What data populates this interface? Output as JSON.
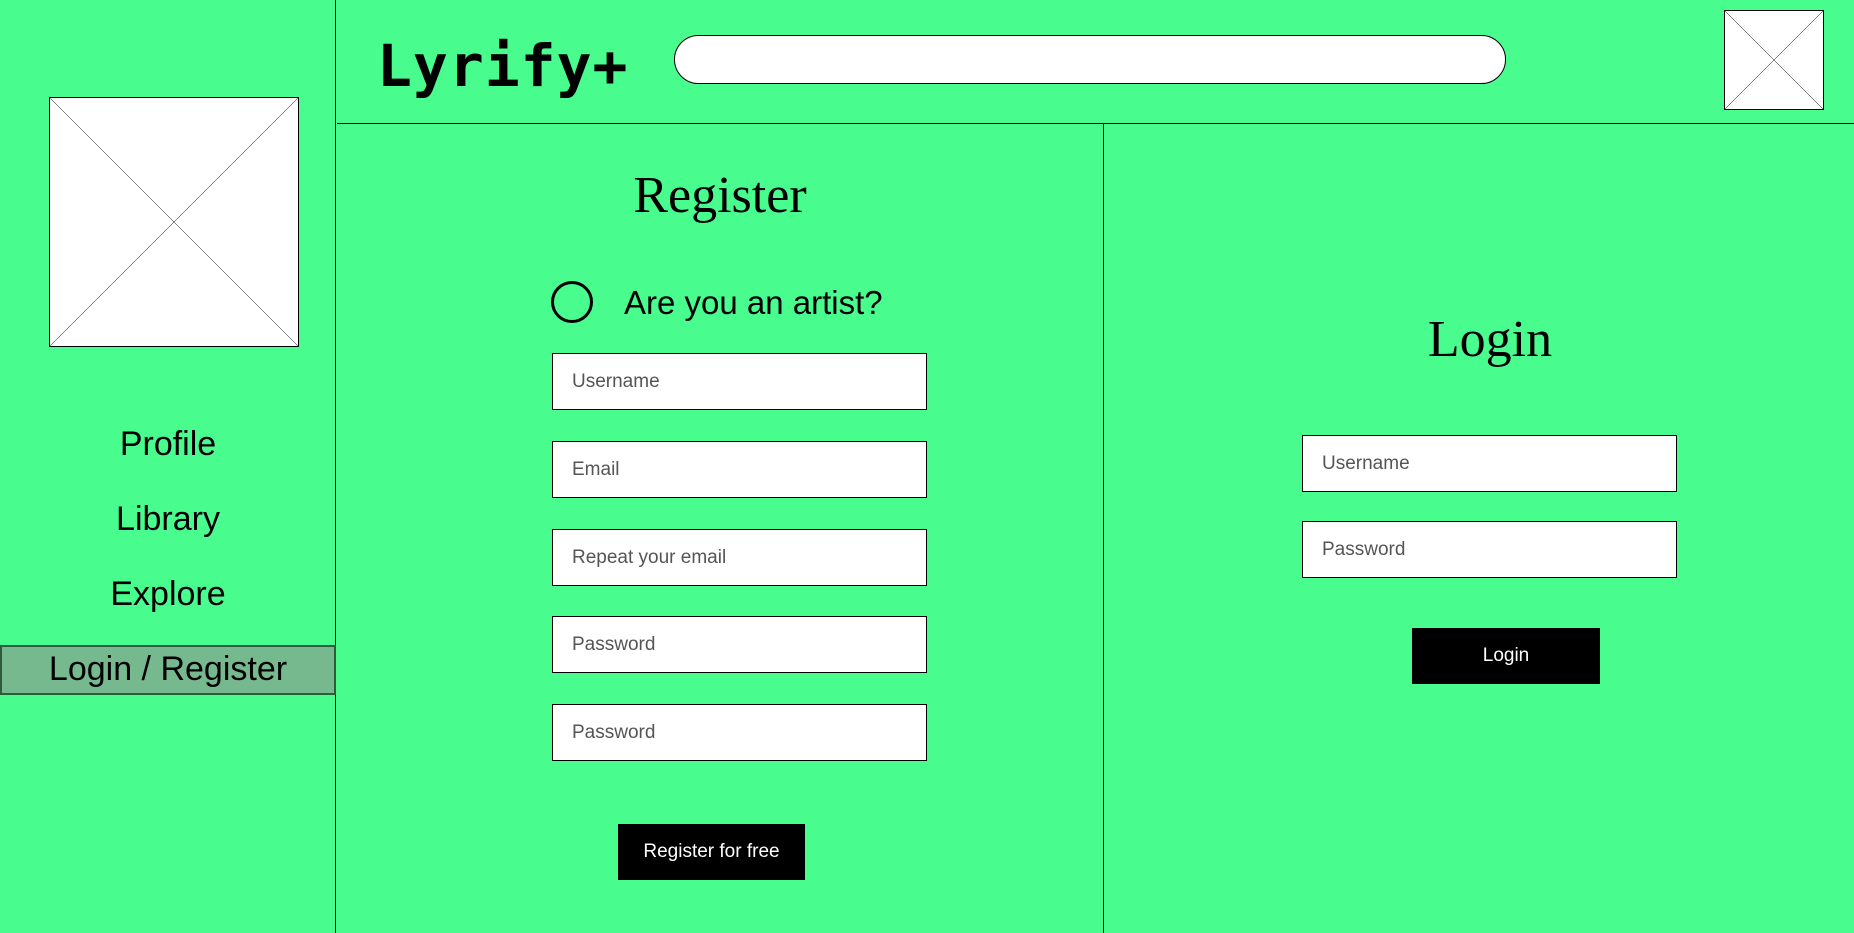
{
  "header": {
    "logo": "Lyrify+",
    "search": {
      "value": "",
      "placeholder": ""
    },
    "avatar_icon": "image-placeholder-icon"
  },
  "sidebar": {
    "avatar_icon": "image-placeholder-icon",
    "items": [
      {
        "label": "Profile",
        "active": false
      },
      {
        "label": "Library",
        "active": false
      },
      {
        "label": "Explore",
        "active": false
      },
      {
        "label": "Login / Register",
        "active": true
      }
    ]
  },
  "register": {
    "title": "Register",
    "artist_label": "Are you an artist?",
    "artist_checked": false,
    "fields": [
      {
        "placeholder": "Username",
        "value": ""
      },
      {
        "placeholder": "Email",
        "value": ""
      },
      {
        "placeholder": "Repeat your email",
        "value": ""
      },
      {
        "placeholder": "Password",
        "value": ""
      },
      {
        "placeholder": "Password",
        "value": ""
      }
    ],
    "button_label": "Register for free"
  },
  "login": {
    "title": "Login",
    "fields": [
      {
        "placeholder": "Username",
        "value": ""
      },
      {
        "placeholder": "Password",
        "value": ""
      }
    ],
    "button_label": "Login"
  },
  "colors": {
    "background": "#48fd8e",
    "active_nav": "#77b98e",
    "button": "#000000",
    "button_text": "#ffffff"
  }
}
